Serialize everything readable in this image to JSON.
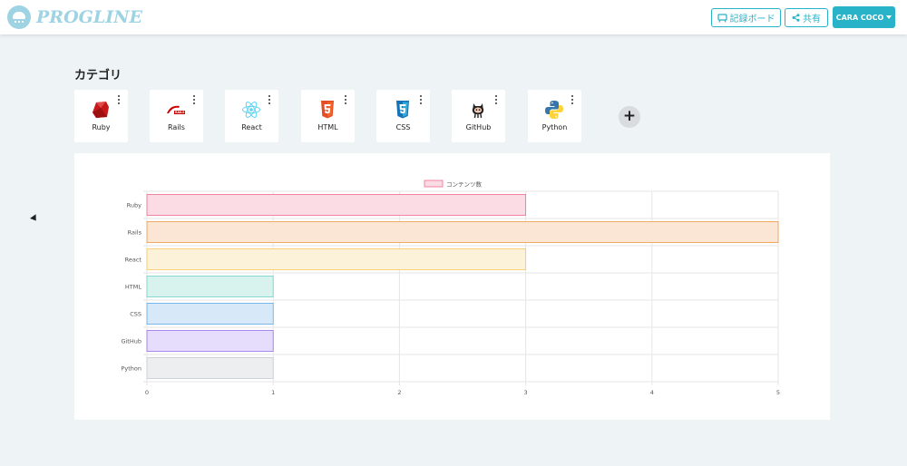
{
  "header": {
    "logo_text": "PROGLINE",
    "board_button": "記録ボード",
    "share_button": "共有",
    "user_button": "CARA COCO"
  },
  "section_title": "カテゴリ",
  "categories": [
    {
      "label": "Ruby",
      "icon": "ruby-icon"
    },
    {
      "label": "Rails",
      "icon": "rails-icon"
    },
    {
      "label": "React",
      "icon": "react-icon"
    },
    {
      "label": "HTML",
      "icon": "html5-icon"
    },
    {
      "label": "CSS",
      "icon": "css3-icon"
    },
    {
      "label": "GitHub",
      "icon": "github-octocat-icon"
    },
    {
      "label": "Python",
      "icon": "python-icon"
    }
  ],
  "add_button": "+",
  "colors": {
    "accent": "#29b3c8",
    "logo": "#9ed3e3"
  },
  "chart_data": {
    "type": "bar",
    "orientation": "horizontal",
    "categories": [
      "Ruby",
      "Rails",
      "React",
      "HTML",
      "CSS",
      "GitHub",
      "Python"
    ],
    "series": [
      {
        "name": "コンテンツ数",
        "values": [
          3,
          5,
          3,
          1,
          1,
          1,
          1
        ]
      }
    ],
    "xlim": [
      0,
      5
    ],
    "xticks": [
      "0",
      "1",
      "2",
      "3",
      "4",
      "5"
    ],
    "legend_position": "top",
    "grid": true,
    "bar_colors": [
      {
        "fill": "#fbdbe4",
        "stroke": "#f06a8f"
      },
      {
        "fill": "#fbe6d6",
        "stroke": "#f0983f"
      },
      {
        "fill": "#fcf2d9",
        "stroke": "#f5c95a"
      },
      {
        "fill": "#d8f2ee",
        "stroke": "#6fd0c3"
      },
      {
        "fill": "#d7e9f8",
        "stroke": "#5aa9e6"
      },
      {
        "fill": "#e6dcfb",
        "stroke": "#9a6cf0"
      },
      {
        "fill": "#eceeef",
        "stroke": "#c6cacd"
      }
    ]
  }
}
